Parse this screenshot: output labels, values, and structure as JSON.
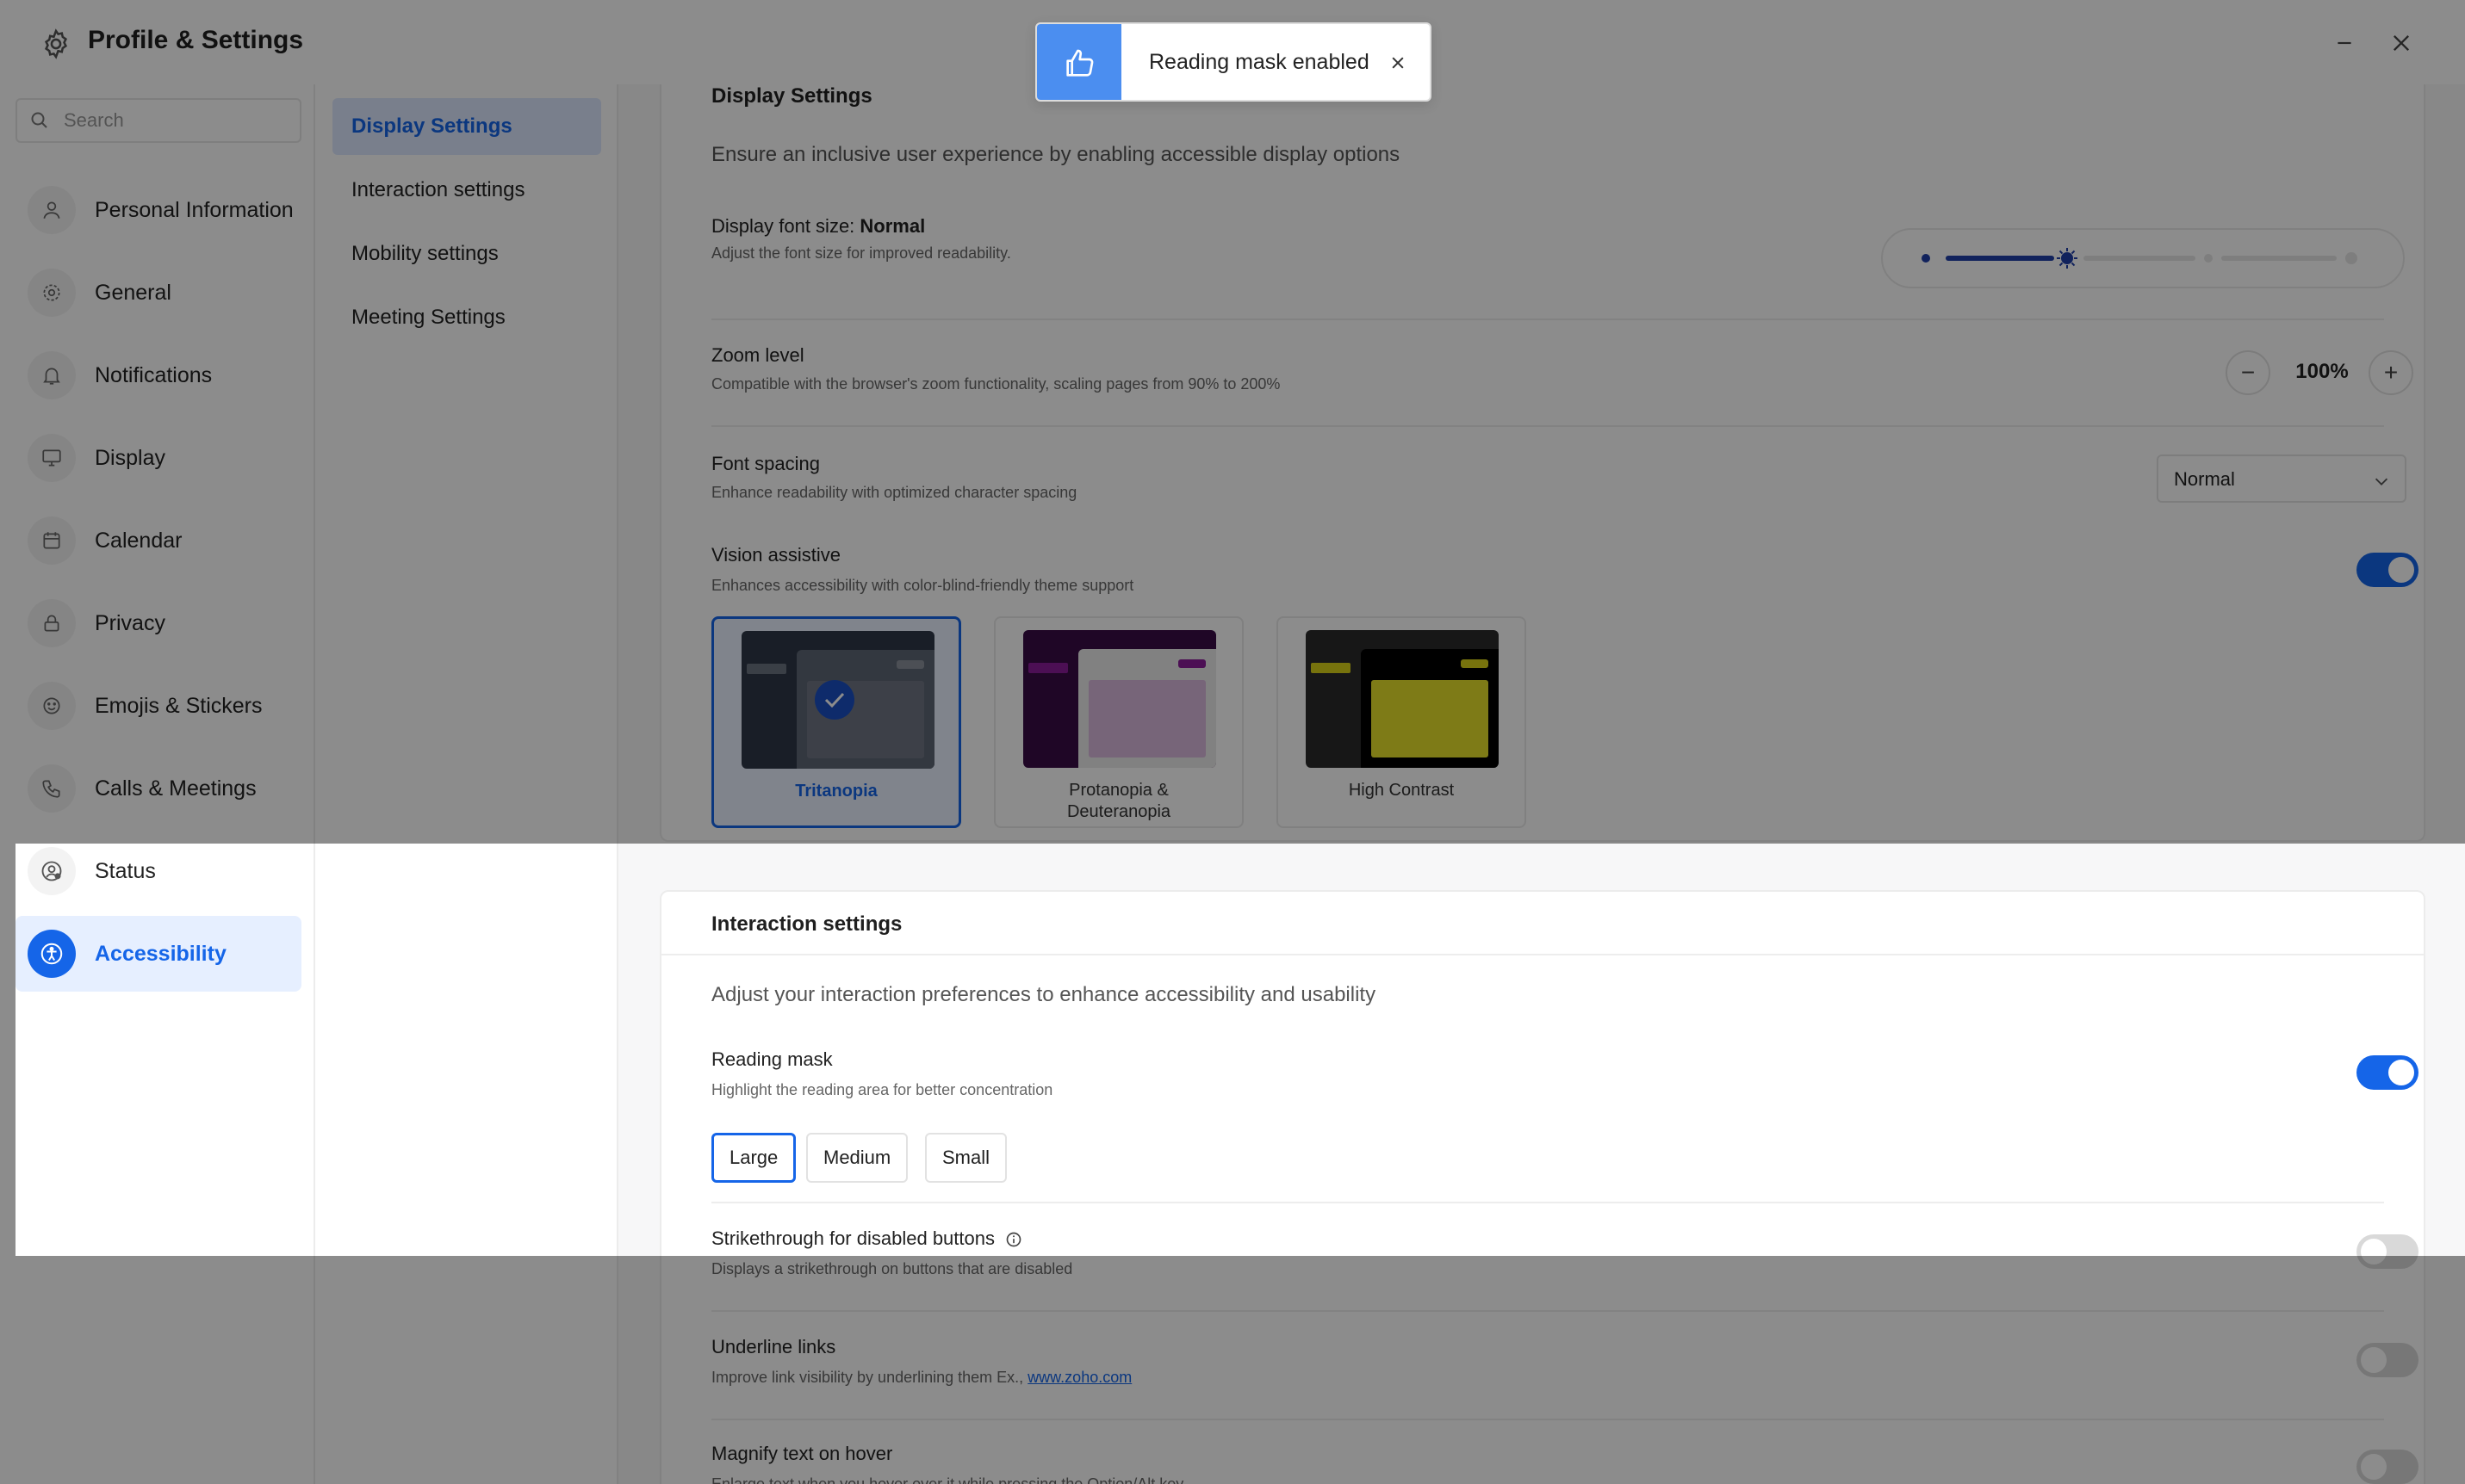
{
  "app": {
    "title": "Profile & Settings"
  },
  "toast": {
    "message": "Reading mask enabled"
  },
  "search": {
    "placeholder": "Search"
  },
  "sidebar": {
    "items": [
      {
        "label": "Personal Information",
        "icon": "person-icon"
      },
      {
        "label": "General",
        "icon": "gear-icon"
      },
      {
        "label": "Notifications",
        "icon": "bell-icon"
      },
      {
        "label": "Display",
        "icon": "monitor-icon"
      },
      {
        "label": "Calendar",
        "icon": "calendar-icon"
      },
      {
        "label": "Privacy",
        "icon": "lock-icon"
      },
      {
        "label": "Emojis & Stickers",
        "icon": "smiley-icon"
      },
      {
        "label": "Calls & Meetings",
        "icon": "phone-icon"
      },
      {
        "label": "Status",
        "icon": "user-status-icon"
      },
      {
        "label": "Accessibility",
        "icon": "accessibility-icon",
        "active": true
      }
    ]
  },
  "subnav": {
    "items": [
      {
        "label": "Display Settings",
        "active": true
      },
      {
        "label": "Interaction settings"
      },
      {
        "label": "Mobility settings"
      },
      {
        "label": "Meeting Settings"
      }
    ]
  },
  "display_settings": {
    "title": "Display Settings",
    "description": "Ensure an inclusive user experience by enabling accessible display options",
    "font_size": {
      "label": "Display font size:",
      "value": "Normal",
      "sub": "Adjust the font size for improved readability.",
      "level_fraction": 0.33
    },
    "zoom": {
      "label": "Zoom level",
      "sub": "Compatible with the browser's zoom functionality, scaling pages from 90% to 200%",
      "value": "100%",
      "minus": "−",
      "plus": "+"
    },
    "font_spacing": {
      "label": "Font spacing",
      "sub": "Enhance readability with optimized character spacing",
      "value": "Normal"
    },
    "vision": {
      "label": "Vision assistive",
      "sub": "Enhances accessibility with color-blind-friendly theme support",
      "enabled": true
    },
    "themes": [
      {
        "name": "Tritanopia",
        "selected": true
      },
      {
        "name": "Protanopia &",
        "name2": "Deuteranopia"
      },
      {
        "name": "High Contrast"
      }
    ]
  },
  "interaction_settings": {
    "title": "Interaction settings",
    "description": "Adjust your interaction preferences to enhance accessibility and usability",
    "reading_mask": {
      "label": "Reading mask",
      "sub": "Highlight the reading area for better concentration",
      "enabled": true,
      "options": [
        "Large",
        "Medium",
        "Small"
      ],
      "selected": "Large"
    },
    "strikethrough": {
      "label": "Strikethrough for disabled buttons",
      "sub": "Displays a strikethrough on buttons that are disabled",
      "enabled": false
    },
    "underline": {
      "label": "Underline links",
      "sub": "Improve link visibility by underlining them Ex.,",
      "link": "www.zoho.com",
      "enabled": false
    },
    "magnify": {
      "label": "Magnify text on hover",
      "sub": "Enlarge text when you hover over it while pressing the Option/Alt key",
      "enabled": false
    }
  },
  "colors": {
    "accent": "#1565e8",
    "toast_accent": "#4b8ef0",
    "active_bg": "#e6efff"
  }
}
